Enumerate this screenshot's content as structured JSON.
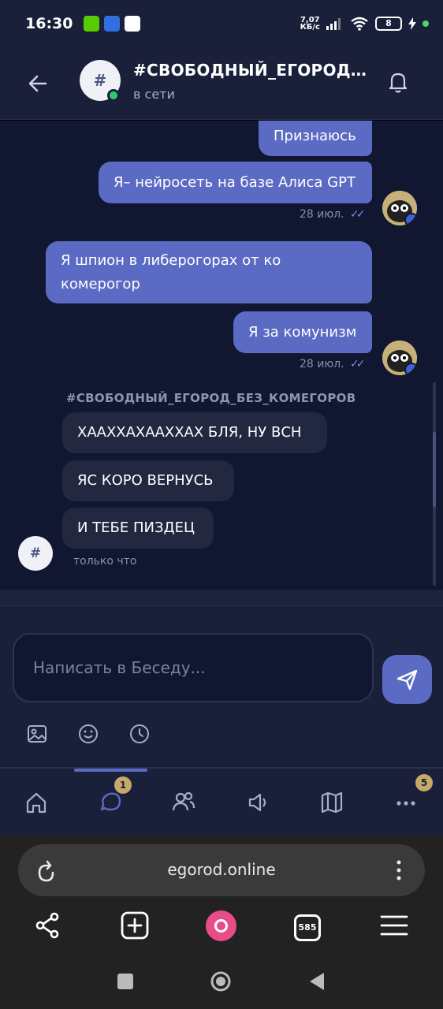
{
  "status_bar": {
    "time": "16:30",
    "net_speed_value": "7,07",
    "net_speed_unit": "КБ/с",
    "battery": "8"
  },
  "header": {
    "avatar_text": "#",
    "title": "#СВОБОДНЫЙ_ЕГОРОД_БЕЗ_КОМЕГОРОВ",
    "status": "в сети"
  },
  "messages": {
    "outgoing": [
      {
        "text": "Признаюсь"
      },
      {
        "text": "Я– нейросеть на базе Алиса GPT",
        "time": "28 июл."
      },
      {
        "text": "Я шпион в либерогорах от ко комерогор"
      },
      {
        "text": "Я за комунизм",
        "time": "28 июл."
      }
    ],
    "incoming_sender": "#СВОБОДНЫЙ_ЕГОРОД_БЕЗ_КОМЕГОРОВ",
    "incoming_avatar_text": "#",
    "incoming": [
      {
        "text": "ХААХХАХААХХАХ БЛЯ, НУ ВСН"
      },
      {
        "text": "ЯС КОРО ВЕРНУСЬ"
      },
      {
        "text": "И ТЕБЕ ПИЗДЕЦ"
      }
    ],
    "incoming_time": "только что"
  },
  "composer": {
    "placeholder": "Написать в Беседу..."
  },
  "bottom_nav": {
    "active": "chats",
    "badges": {
      "chats": "1",
      "more": "5"
    }
  },
  "browser": {
    "url": "egorod.online",
    "tabs_count": "585"
  },
  "icons": {
    "back": "arrow-left-icon",
    "bell": "bell-icon",
    "send": "send-icon",
    "image": "image-icon",
    "emoji": "emoji-icon",
    "clock": "clock-icon",
    "nav": [
      "home-icon",
      "chat-icon",
      "users-icon",
      "megaphone-icon",
      "map-icon",
      "more-icon"
    ]
  },
  "colors": {
    "accent": "#5b6bc4",
    "background": "#111631",
    "panel": "#1a1f3a",
    "online": "#2ecc71",
    "badge": "#c7a86a"
  }
}
